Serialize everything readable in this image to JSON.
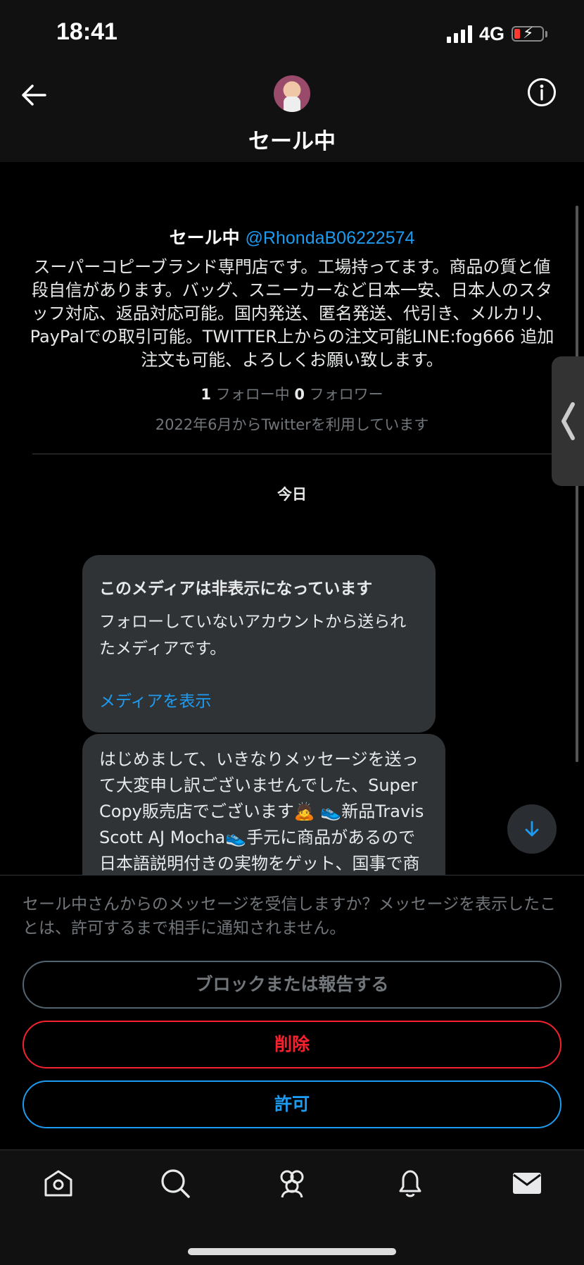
{
  "status_bar": {
    "time": "18:41",
    "network": "4G",
    "battery_level": 0.15
  },
  "header": {
    "title": "セール中",
    "back_icon": "arrow-left-icon",
    "info_icon": "info-icon"
  },
  "profile": {
    "name": "セール中",
    "handle": "@RhondaB06222574",
    "bio": "スーパーコピーブランド専門店です。工場持ってます。商品の質と値段自信があります。バッグ、スニーカーなど日本一安、日本人のスタッフ対応、返品対応可能。国内発送、匿名発送、代引き、メルカリ、PayPalでの取引可能。TWITTER上からの注文可能LINE:fog666 追加注文も可能、よろしくお願い致します。",
    "following_count": "1",
    "following_label": "フォロー中",
    "followers_count": "0",
    "followers_label": "フォロワー",
    "joined": "2022年6月からTwitterを利用しています"
  },
  "conversation": {
    "date_separator": "今日",
    "media_message": {
      "title": "このメディアは非表示になっています",
      "description": "フォローしていないアカウントから送られたメディアです。",
      "link": "メディアを表示"
    },
    "text_message": "はじめまして、いきなりメッセージを送って大変申し訳ございませんでした、Super Copy販売店でございます🙇 👟新品Travis Scott AJ Mocha👟手元に商品があるので日本語説明付きの実物をゲット、国事で商品確認可能"
  },
  "request": {
    "prompt": "セール中さんからのメッセージを受信しますか？メッセージを表示したことは、許可するまで相手に通知されません。",
    "block_label": "ブロックまたは報告する",
    "delete_label": "削除",
    "allow_label": "許可"
  },
  "tab_bar": {
    "items": [
      "home-icon",
      "search-icon",
      "communities-icon",
      "notifications-icon",
      "messages-icon"
    ]
  },
  "colors": {
    "accent": "#1d9bf0",
    "danger": "#f4212e",
    "background": "#000000"
  }
}
